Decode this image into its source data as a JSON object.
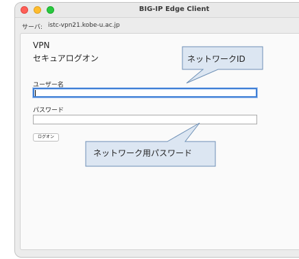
{
  "window": {
    "title": "BIG-IP Edge Client"
  },
  "server": {
    "label": "サーバ:",
    "value": "istc-vpn21.kobe-u.ac.jp"
  },
  "form": {
    "heading_line1": "VPN",
    "heading_line2": "セキュアログオン",
    "username_label": "ユーザー名",
    "username_value": "",
    "password_label": "パスワード",
    "password_value": "",
    "login_button": "ログオン"
  },
  "annotations": {
    "network_id": "ネットワークID",
    "network_password": "ネットワーク用パスワード"
  },
  "colors": {
    "focus_ring": "#3f7fd6",
    "callout_fill": "#dce6f2",
    "callout_stroke": "#6d8fb5"
  },
  "icons": [
    "close-icon",
    "minimize-icon",
    "zoom-icon"
  ]
}
